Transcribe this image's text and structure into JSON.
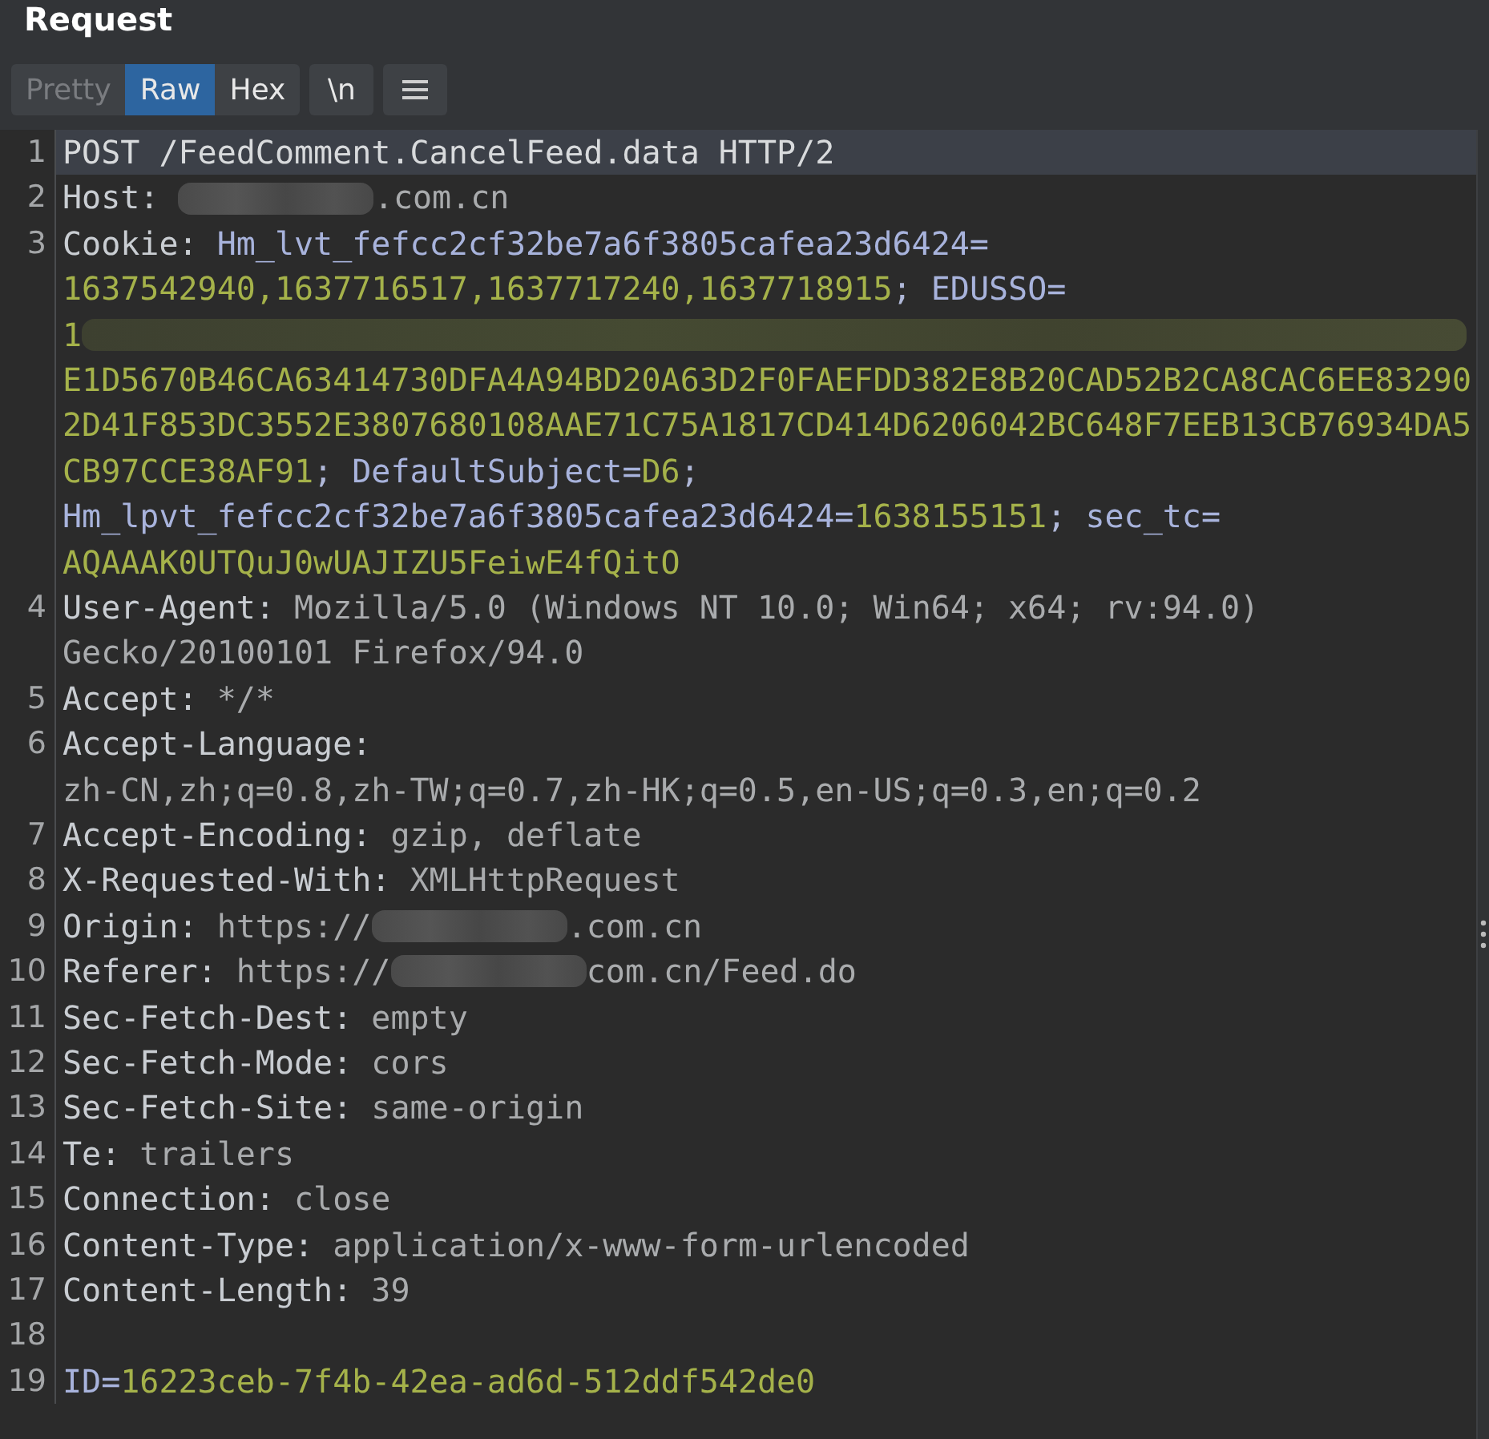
{
  "panel": {
    "title": "Request"
  },
  "view_tabs": [
    {
      "label": "Pretty",
      "selected": false,
      "disabled": true
    },
    {
      "label": "Raw",
      "selected": true,
      "disabled": false
    },
    {
      "label": "Hex",
      "selected": false,
      "disabled": false
    }
  ],
  "newline_toggle": {
    "label": "\\n"
  },
  "lines": [
    {
      "number": "1",
      "highlighted": true,
      "rows": [
        {
          "segments": [
            {
              "kind": "plain",
              "text": "POST /FeedComment.CancelFeed.data HTTP/2"
            }
          ]
        }
      ]
    },
    {
      "number": "2",
      "highlighted": false,
      "rows": [
        {
          "segments": [
            {
              "kind": "key",
              "text": "Host: "
            },
            {
              "kind": "redaction"
            },
            {
              "kind": "value",
              "text": ".com.cn"
            }
          ]
        }
      ]
    },
    {
      "number": "3",
      "highlighted": false,
      "rows": [
        {
          "segments": [
            {
              "kind": "key",
              "text": "Cookie: "
            },
            {
              "kind": "cookie-name",
              "text": "Hm_lvt_fefcc2cf32be7a6f3805cafea23d6424="
            }
          ]
        },
        {
          "segments": [
            {
              "kind": "cookie-value",
              "text": "1637542940,1637716517,1637717240,1637718915"
            },
            {
              "kind": "punct",
              "text": "; "
            },
            {
              "kind": "cookie-name",
              "text": "EDUSSO="
            }
          ]
        },
        {
          "segments": [
            {
              "kind": "cookie-value",
              "text": "1"
            },
            {
              "kind": "redaction-row"
            }
          ]
        },
        {
          "segments": [
            {
              "kind": "cookie-value",
              "text": "E1D5670B46CA63414730DFA4A94BD20A63D2F0FAEFDD382E8B20CAD52B2CA8CAC6EE83290"
            }
          ]
        },
        {
          "segments": [
            {
              "kind": "cookie-value",
              "text": "2D41F853DC3552E3807680108AAE71C75A1817CD414D6206042BC648F7EEB13CB76934DA5"
            }
          ]
        },
        {
          "segments": [
            {
              "kind": "cookie-value",
              "text": "CB97CCE38AF91"
            },
            {
              "kind": "punct",
              "text": "; "
            },
            {
              "kind": "cookie-name",
              "text": "DefaultSubject="
            },
            {
              "kind": "cookie-value",
              "text": "D6"
            },
            {
              "kind": "punct",
              "text": ";"
            }
          ]
        },
        {
          "segments": [
            {
              "kind": "cookie-name",
              "text": "Hm_lpvt_fefcc2cf32be7a6f3805cafea23d6424="
            },
            {
              "kind": "cookie-value",
              "text": "1638155151"
            },
            {
              "kind": "punct",
              "text": "; "
            },
            {
              "kind": "cookie-name",
              "text": "sec_tc="
            }
          ]
        },
        {
          "segments": [
            {
              "kind": "cookie-value",
              "text": "AQAAAK0UTQuJ0wUAJIZU5FeiwE4fQitO"
            }
          ]
        }
      ]
    },
    {
      "number": "4",
      "highlighted": false,
      "rows": [
        {
          "segments": [
            {
              "kind": "key",
              "text": "User-Agent: "
            },
            {
              "kind": "value",
              "text": "Mozilla/5.0 (Windows NT 10.0; Win64; x64; rv:94.0)"
            }
          ]
        },
        {
          "segments": [
            {
              "kind": "value",
              "text": "Gecko/20100101 Firefox/94.0"
            }
          ]
        }
      ]
    },
    {
      "number": "5",
      "highlighted": false,
      "rows": [
        {
          "segments": [
            {
              "kind": "key",
              "text": "Accept: "
            },
            {
              "kind": "value",
              "text": "*/*"
            }
          ]
        }
      ]
    },
    {
      "number": "6",
      "highlighted": false,
      "rows": [
        {
          "segments": [
            {
              "kind": "key",
              "text": "Accept-Language:"
            }
          ]
        },
        {
          "segments": [
            {
              "kind": "value",
              "text": "zh-CN,zh;q=0.8,zh-TW;q=0.7,zh-HK;q=0.5,en-US;q=0.3,en;q=0.2"
            }
          ]
        }
      ]
    },
    {
      "number": "7",
      "highlighted": false,
      "rows": [
        {
          "segments": [
            {
              "kind": "key",
              "text": "Accept-Encoding: "
            },
            {
              "kind": "value",
              "text": "gzip, deflate"
            }
          ]
        }
      ]
    },
    {
      "number": "8",
      "highlighted": false,
      "rows": [
        {
          "segments": [
            {
              "kind": "key",
              "text": "X-Requested-With: "
            },
            {
              "kind": "value",
              "text": "XMLHttpRequest"
            }
          ]
        }
      ]
    },
    {
      "number": "9",
      "highlighted": false,
      "rows": [
        {
          "segments": [
            {
              "kind": "key",
              "text": "Origin: "
            },
            {
              "kind": "value",
              "text": "https://"
            },
            {
              "kind": "redaction"
            },
            {
              "kind": "value",
              "text": ".com.cn"
            }
          ]
        }
      ]
    },
    {
      "number": "10",
      "highlighted": false,
      "rows": [
        {
          "segments": [
            {
              "kind": "key",
              "text": "Referer: "
            },
            {
              "kind": "value",
              "text": "https://"
            },
            {
              "kind": "redaction"
            },
            {
              "kind": "value",
              "text": "com.cn/Feed.do"
            }
          ]
        }
      ]
    },
    {
      "number": "11",
      "highlighted": false,
      "rows": [
        {
          "segments": [
            {
              "kind": "key",
              "text": "Sec-Fetch-Dest: "
            },
            {
              "kind": "value",
              "text": "empty"
            }
          ]
        }
      ]
    },
    {
      "number": "12",
      "highlighted": false,
      "rows": [
        {
          "segments": [
            {
              "kind": "key",
              "text": "Sec-Fetch-Mode: "
            },
            {
              "kind": "value",
              "text": "cors"
            }
          ]
        }
      ]
    },
    {
      "number": "13",
      "highlighted": false,
      "rows": [
        {
          "segments": [
            {
              "kind": "key",
              "text": "Sec-Fetch-Site: "
            },
            {
              "kind": "value",
              "text": "same-origin"
            }
          ]
        }
      ]
    },
    {
      "number": "14",
      "highlighted": false,
      "rows": [
        {
          "segments": [
            {
              "kind": "key",
              "text": "Te: "
            },
            {
              "kind": "value",
              "text": "trailers"
            }
          ]
        }
      ]
    },
    {
      "number": "15",
      "highlighted": false,
      "rows": [
        {
          "segments": [
            {
              "kind": "key",
              "text": "Connection: "
            },
            {
              "kind": "value",
              "text": "close"
            }
          ]
        }
      ]
    },
    {
      "number": "16",
      "highlighted": false,
      "rows": [
        {
          "segments": [
            {
              "kind": "key",
              "text": "Content-Type: "
            },
            {
              "kind": "value",
              "text": "application/x-www-form-urlencoded"
            }
          ]
        }
      ]
    },
    {
      "number": "17",
      "highlighted": false,
      "rows": [
        {
          "segments": [
            {
              "kind": "key",
              "text": "Content-Length: "
            },
            {
              "kind": "value",
              "text": "39"
            }
          ]
        }
      ]
    },
    {
      "number": "18",
      "highlighted": false
    },
    {
      "number": "19",
      "highlighted": false,
      "rows": [
        {
          "segments": [
            {
              "kind": "cookie-name",
              "text": "ID="
            },
            {
              "kind": "cookie-value",
              "text": "16223ceb-7f4b-42ea-ad6d-512ddf542de0"
            }
          ]
        }
      ]
    }
  ]
}
